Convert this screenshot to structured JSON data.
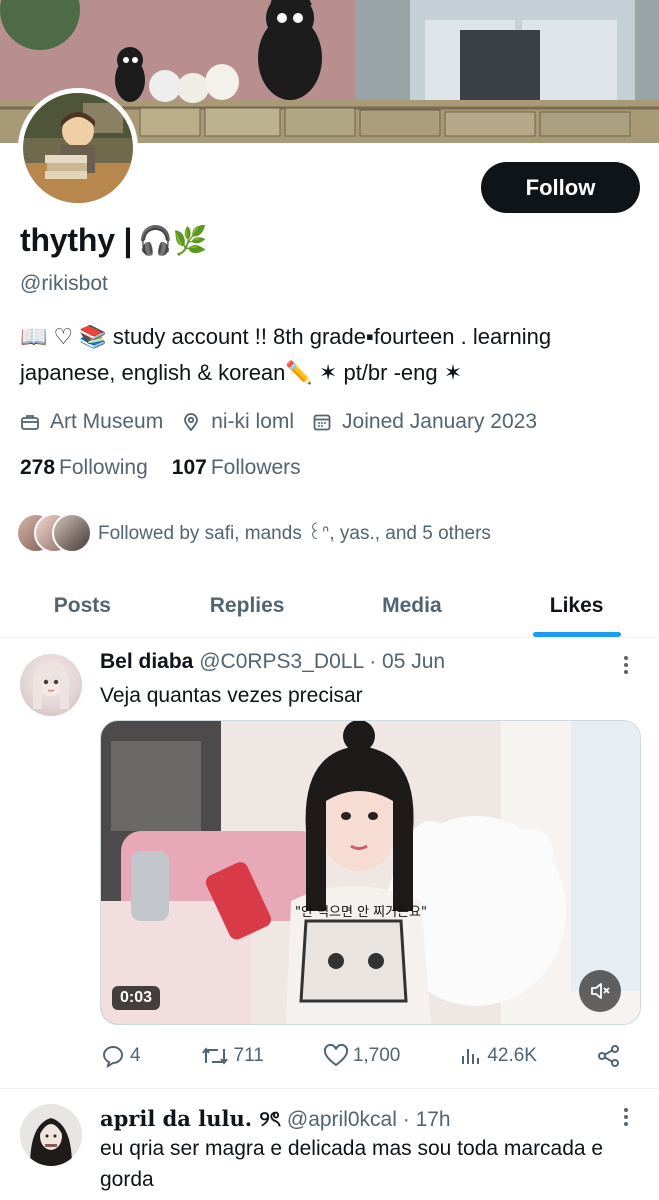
{
  "profile": {
    "display_name": "thythy |",
    "name_emoji": "🎧🌿",
    "handle": "@rikisbot",
    "follow_label": "Follow",
    "bio_line1": "📖  ♡  📚   study account !! 8th grade▪fourteen . learning",
    "bio_line2": "japanese, english & korean✏️ ✶ pt/br -eng ✶",
    "meta": {
      "work": "Art Museum",
      "location": "ni-ki loml",
      "joined": "Joined January 2023"
    },
    "following_count": "278",
    "following_label": "Following",
    "followers_count": "107",
    "followers_label": "Followers",
    "followed_by": "Followed by safi, mands ꒰ᐢ, yas., and 5 others"
  },
  "tabs": [
    {
      "label": "Posts",
      "active": false
    },
    {
      "label": "Replies",
      "active": false
    },
    {
      "label": "Media",
      "active": false
    },
    {
      "label": "Likes",
      "active": true
    }
  ],
  "tweets": [
    {
      "name": "Bel diaba",
      "handle": "@C0RPS3_D0LL",
      "time": "· 05 Jun",
      "text": "Veja quantas vezes precisar",
      "video_duration": "0:03",
      "replies": "4",
      "reposts": "711",
      "likes": "1,700",
      "views": "42.6K"
    },
    {
      "name": "april da lulu. ୨ৎ",
      "handle": "@april0kcal",
      "time": "· 17h",
      "text": "eu qria ser magra e delicada mas sou toda marcada e gorda"
    }
  ],
  "colors": {
    "accent": "#1d9bf0",
    "text_primary": "#0f1419",
    "text_secondary": "#536471",
    "follow_button_bg": "#0f1419"
  },
  "icons": {
    "work": "briefcase-icon",
    "location": "location-pin-icon",
    "joined": "calendar-icon",
    "more": "more-vertical-icon",
    "reply": "reply-icon",
    "repost": "repost-icon",
    "like": "heart-icon",
    "views": "views-icon",
    "share": "share-icon",
    "mute": "muted-speaker-icon"
  }
}
